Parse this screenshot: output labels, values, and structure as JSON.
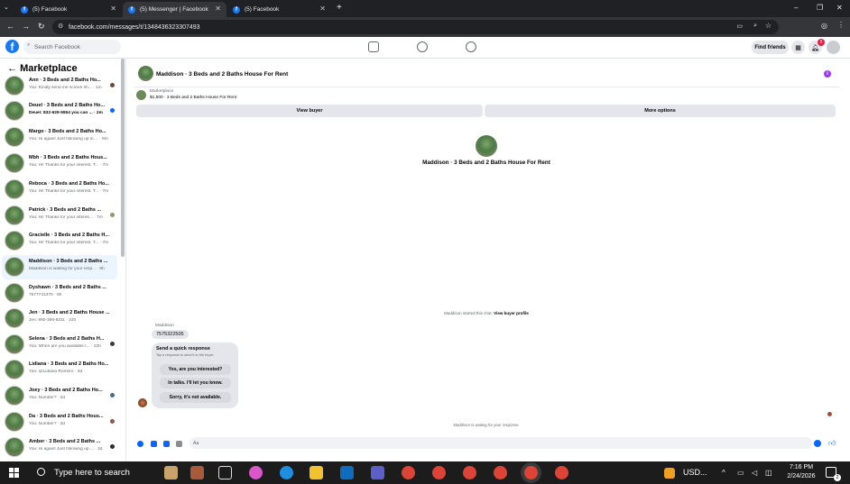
{
  "browser": {
    "tabs": [
      {
        "label": "(5) Facebook",
        "active": false
      },
      {
        "label": "(5) Messenger | Facebook",
        "active": true
      },
      {
        "label": "(5) Facebook",
        "active": false
      }
    ],
    "new_tab": "+",
    "url": "facebook.com/messages/t/1348436323307493",
    "window_controls": [
      "–",
      "❐",
      "✕"
    ]
  },
  "fb": {
    "logo": "f",
    "search_placeholder": "Search Facebook",
    "find_friends": "Find friends",
    "notif_count": "5"
  },
  "sidebar": {
    "heading": "Marketplace",
    "items": [
      {
        "title": "Ann · 3 Beds and 2 Baths Ho...",
        "sub": "You: Kindly send me screen sh... · 1m",
        "dot": "#6b4a3a",
        "bold": false
      },
      {
        "title": "Deuel · 3 Beds and 2 Baths Ho...",
        "sub": "Deuel: 832-629-5554 you can ... · 2m",
        "dot": "#0866ff",
        "bold": true
      },
      {
        "title": "Margo · 3 Beds and 2 Baths Ho...",
        "sub": "You: Hi again! Just following up in ... · 6m",
        "dot": "",
        "bold": false
      },
      {
        "title": "Mbh · 3 Beds and 2 Baths Hous...",
        "sub": "You: Hi! Thanks for your interest. T... · 7m",
        "dot": "",
        "bold": false
      },
      {
        "title": "Reboca · 3 Beds and 2 Baths Ho...",
        "sub": "You: Hi! Thanks for your interest. T... · 7m",
        "dot": "",
        "bold": false
      },
      {
        "title": "Patrick · 3 Beds and 2 Baths ...",
        "sub": "You: Hi! Thanks for your interes... · 7m",
        "dot": "#8a9a6a",
        "bold": false
      },
      {
        "title": "Gracielle · 3 Beds and 2 Baths H...",
        "sub": "You: Hi! Thanks for your interest. T... · 7m",
        "dot": "",
        "bold": false
      },
      {
        "title": "Maddison · 3 Beds and 2 Baths ...",
        "sub": "Maddison is waiting for your resp... · 8h",
        "dot": "",
        "bold": false
      },
      {
        "title": "Dyshawn · 3 Beds and 2 Baths ...",
        "sub": "7577741370 · 9h",
        "dot": "",
        "bold": false
      },
      {
        "title": "Jen · 3 Beds and 2 Baths House ...",
        "sub": "Jen: 980-398-8311 · 22h",
        "dot": "",
        "bold": false
      },
      {
        "title": "Selena · 3 Beds and 2 Baths H...",
        "sub": "You: When are you available t... · 22h",
        "dot": "#3a3a3a",
        "bold": false
      },
      {
        "title": "Lidiana · 3 Beds and 2 Baths Ho...",
        "sub": "You: @Lidiana Romero · 2d",
        "dot": "",
        "bold": false
      },
      {
        "title": "Joey · 3 Beds and 2 Baths Ho...",
        "sub": "You: Number? · 2d",
        "dot": "#4a6a8a",
        "bold": false
      },
      {
        "title": "Da · 3 Beds and 2 Baths Hous...",
        "sub": "You: Number? · 2d",
        "dot": "#8a5a4a",
        "bold": false
      },
      {
        "title": "Amber · 3 Beds and 2 Baths ...",
        "sub": "You: Hi again! Just following up ... · 2d",
        "dot": "#2a2a2a",
        "bold": false
      }
    ]
  },
  "chat": {
    "title": "Maddison · 3 Beds and 2 Baths House For Rent",
    "marketplace_label": "Marketplace",
    "listing": "$1,500 · 3 Beds and 2 Baths House For Rent",
    "view_buyer": "View buyer",
    "more_options": "More options",
    "center_title": "Maddison · 3 Beds and 2 Baths House For Rent",
    "started_text": "Maddison started this chat.",
    "view_profile": "View buyer profile",
    "sender_name": "Maddison",
    "message": "7575322505",
    "quick_title": "Send a quick response",
    "quick_sub": "Tap a response to send it to the buyer.",
    "quick_options": [
      "Yes, are you interested?",
      "In talks. I'll let you know.",
      "Sorry, it's not available."
    ],
    "waiting": "Maddison is waiting for your response.",
    "input_placeholder": "Aa"
  },
  "taskbar": {
    "search_placeholder": "Type here to search",
    "currency": "USD...",
    "time": "7:16 PM",
    "date": "2/24/2026",
    "notif_count": "2"
  },
  "colors": {
    "fb_blue": "#1877f2",
    "messenger_blue": "#0866ff",
    "info_purple": "#a033ff"
  }
}
